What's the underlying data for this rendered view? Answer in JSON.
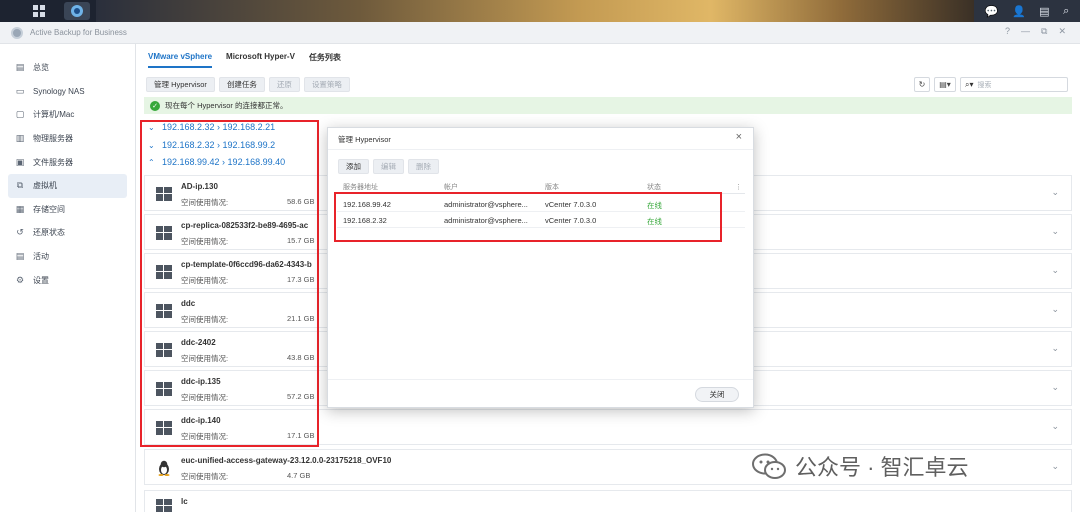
{
  "topbar": {
    "icons": [
      "grid-icon",
      "app-icon",
      "chat-icon",
      "user-icon",
      "widget-icon",
      "search-icon"
    ]
  },
  "window": {
    "title": "Active Backup for Business",
    "controls": [
      "?",
      "—",
      "⧉",
      "✕"
    ]
  },
  "sidebar": {
    "items": [
      {
        "label": "总览",
        "icon": "overview-icon"
      },
      {
        "label": "Synology NAS",
        "icon": "nas-icon"
      },
      {
        "label": "计算机/Mac",
        "icon": "computer-icon"
      },
      {
        "label": "物理服务器",
        "icon": "server-icon"
      },
      {
        "label": "文件服务器",
        "icon": "file-server-icon"
      },
      {
        "label": "虚拟机",
        "icon": "vm-icon",
        "active": true
      },
      {
        "label": "存储空间",
        "icon": "storage-icon"
      },
      {
        "label": "还原状态",
        "icon": "restore-icon"
      },
      {
        "label": "活动",
        "icon": "activity-icon"
      },
      {
        "label": "设置",
        "icon": "settings-icon"
      }
    ]
  },
  "tabs": [
    "VMware vSphere",
    "Microsoft Hyper-V",
    "任务列表"
  ],
  "toolbar": {
    "manage": "管理 Hypervisor",
    "create": "创建任务",
    "restore": "还原",
    "policy": "设置策略"
  },
  "search": {
    "placeholder": "搜索"
  },
  "banner": "现在每个 Hypervisor 的连接都正常。",
  "groups": [
    {
      "label": "192.168.2.32 › 192.168.2.21",
      "expanded": false
    },
    {
      "label": "192.168.2.32 › 192.168.99.2",
      "expanded": false
    },
    {
      "label": "192.168.99.42 › 192.168.99.40",
      "expanded": true
    }
  ],
  "vms": [
    {
      "name": "AD-ip.130",
      "usage_label": "空间使用情况:",
      "size": "58.6 GB",
      "os": "windows"
    },
    {
      "name": "cp-replica-082533f2-be89-4695-ac",
      "usage_label": "空间使用情况:",
      "size": "15.7 GB",
      "os": "windows"
    },
    {
      "name": "cp-template-0f6ccd96-da62-4343-b",
      "usage_label": "空间使用情况:",
      "size": "17.3 GB",
      "os": "windows"
    },
    {
      "name": "ddc",
      "usage_label": "空间使用情况:",
      "size": "21.1 GB",
      "os": "windows"
    },
    {
      "name": "ddc-2402",
      "usage_label": "空间使用情况:",
      "size": "43.8 GB",
      "os": "windows"
    },
    {
      "name": "ddc-ip.135",
      "usage_label": "空间使用情况:",
      "size": "57.2 GB",
      "os": "windows"
    },
    {
      "name": "ddc-ip.140",
      "usage_label": "空间使用情况:",
      "size": "17.1 GB",
      "os": "windows"
    },
    {
      "name": "euc-unified-access-gateway-23.12.0.0-23175218_OVF10",
      "usage_label": "空间使用情况:",
      "size": "4.7 GB",
      "os": "linux"
    },
    {
      "name": "lc",
      "usage_label": "",
      "size": "",
      "os": "windows"
    }
  ],
  "dialog": {
    "title": "管理 Hypervisor",
    "buttons": {
      "add": "添加",
      "edit": "编辑",
      "delete": "删除"
    },
    "columns": [
      "服务器地址",
      "帐户",
      "版本",
      "状态"
    ],
    "rows": [
      {
        "address": "192.168.99.42",
        "account": "administrator@vsphere...",
        "version": "vCenter 7.0.3.0",
        "status": "在线"
      },
      {
        "address": "192.168.2.32",
        "account": "administrator@vsphere...",
        "version": "vCenter 7.0.3.0",
        "status": "在线"
      }
    ],
    "close": "关闭"
  },
  "watermark": "公众号 · 智汇卓云",
  "colors": {
    "accent": "#1e74c7",
    "online": "#37a83b",
    "highlight": "#e8232a",
    "banner": "#e6f5e4"
  }
}
